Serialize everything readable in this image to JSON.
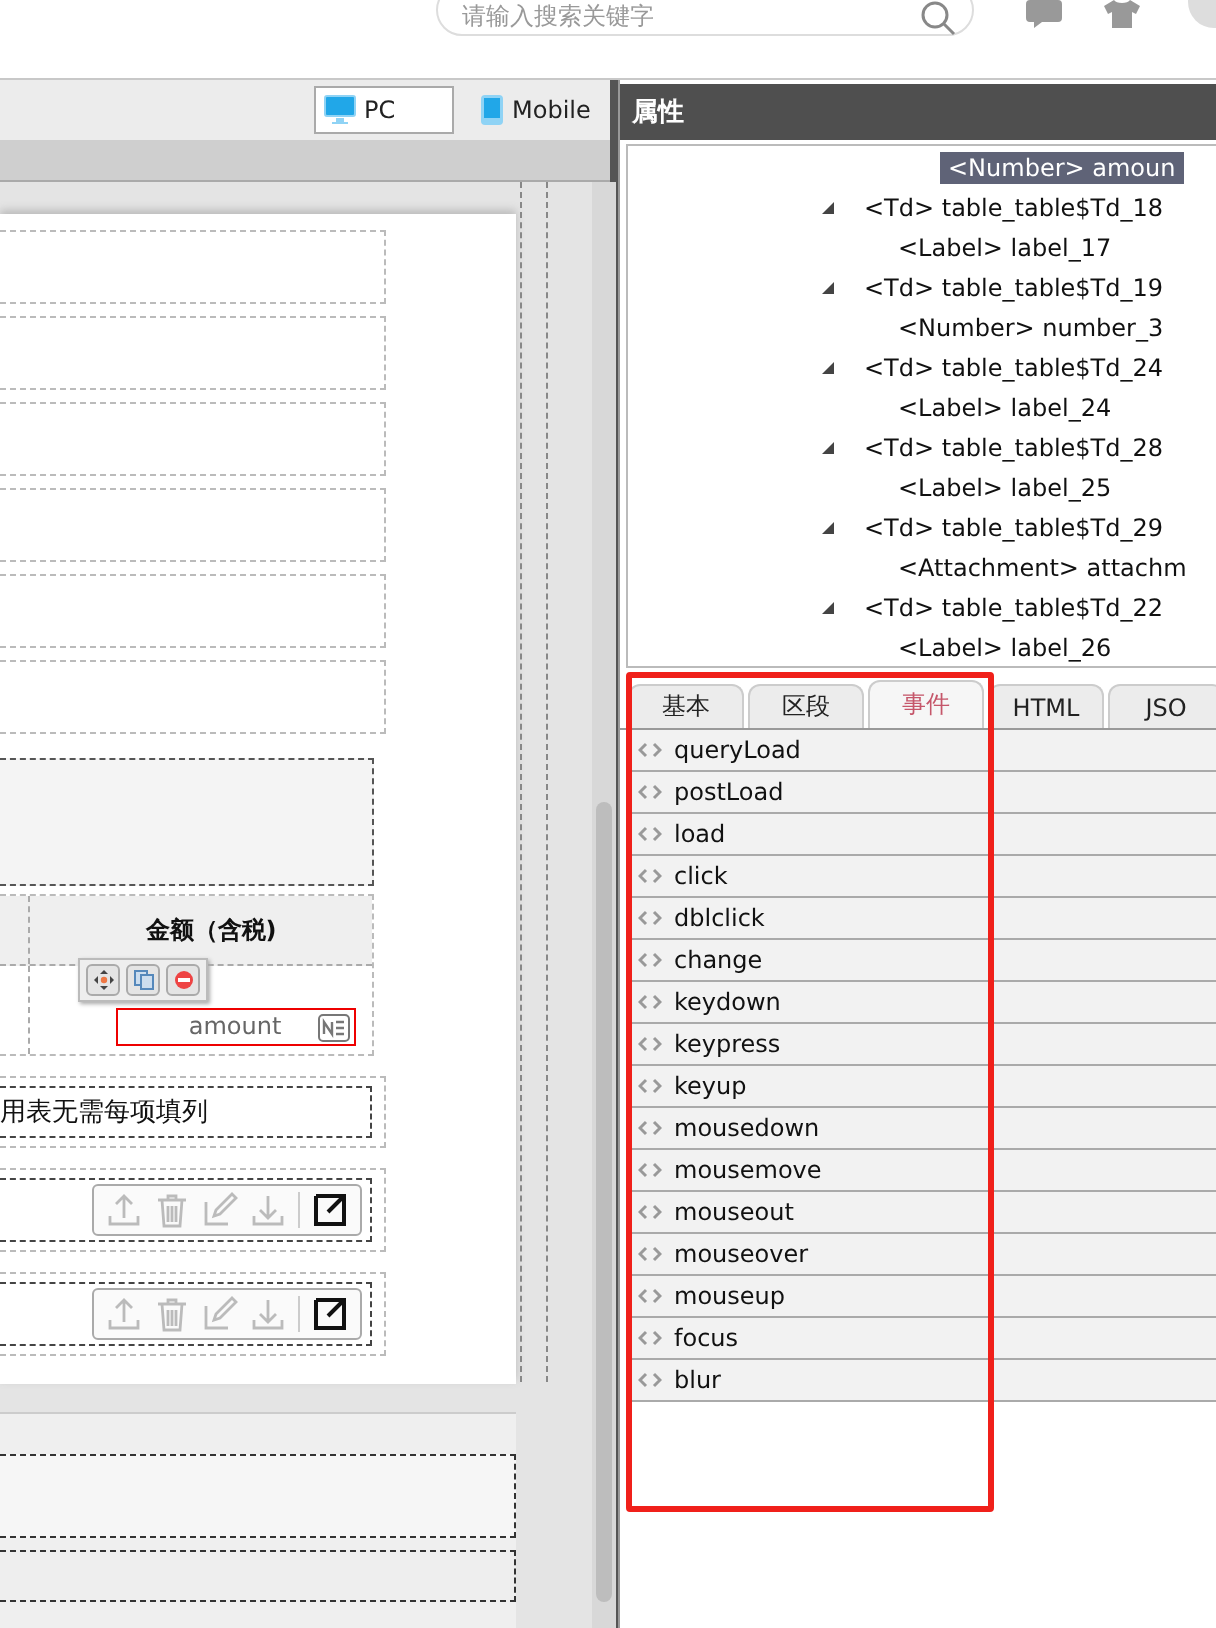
{
  "top_bar": {
    "search": {
      "placeholder": "请输入搜索关键字"
    }
  },
  "view_tabs": [
    {
      "label": "PC",
      "kind": "pc",
      "selected": true
    },
    {
      "label": "Mobile",
      "kind": "mobile",
      "selected": false
    }
  ],
  "canvas": {
    "table": {
      "header": "金额（含税)",
      "field": {
        "value": "amount",
        "selected": true
      }
    },
    "note": "用表无需每项填列"
  },
  "properties": {
    "title": "属性",
    "tree": [
      {
        "text": "<Number> amoun",
        "selected": true
      },
      {
        "text": "<Td> table_table$Td_18",
        "expanded": true,
        "selected": false,
        "children": [
          {
            "text": "<Label> label_17",
            "selected": false
          }
        ]
      },
      {
        "text": "<Td> table_table$Td_19",
        "expanded": true,
        "selected": false,
        "children": [
          {
            "text": "<Number> number_3",
            "selected": false
          }
        ]
      },
      {
        "text": "<Td> table_table$Td_24",
        "expanded": true,
        "selected": false,
        "children": [
          {
            "text": "<Label> label_24",
            "selected": false
          }
        ]
      },
      {
        "text": "<Td> table_table$Td_28",
        "expanded": true,
        "selected": false,
        "children": [
          {
            "text": "<Label> label_25",
            "selected": false
          }
        ]
      },
      {
        "text": "<Td> table_table$Td_29",
        "expanded": true,
        "selected": false,
        "children": [
          {
            "text": "<Attachment> attachm",
            "selected": false
          }
        ]
      },
      {
        "text": "<Td> table_table$Td_22",
        "expanded": true,
        "selected": false,
        "children": [
          {
            "text": "<Label> label_26",
            "selected": false
          }
        ]
      }
    ],
    "tabs": [
      {
        "label": "基本",
        "selected": false
      },
      {
        "label": "区段",
        "selected": false
      },
      {
        "label": "事件",
        "selected": true
      },
      {
        "label": "HTML",
        "selected": false
      },
      {
        "label": "JSO",
        "selected": false
      }
    ],
    "events": [
      "queryLoad",
      "postLoad",
      "load",
      "click",
      "dblclick",
      "change",
      "keydown",
      "keypress",
      "keyup",
      "mousedown",
      "mousemove",
      "mouseout",
      "mouseover",
      "mouseup",
      "focus",
      "blur"
    ]
  }
}
